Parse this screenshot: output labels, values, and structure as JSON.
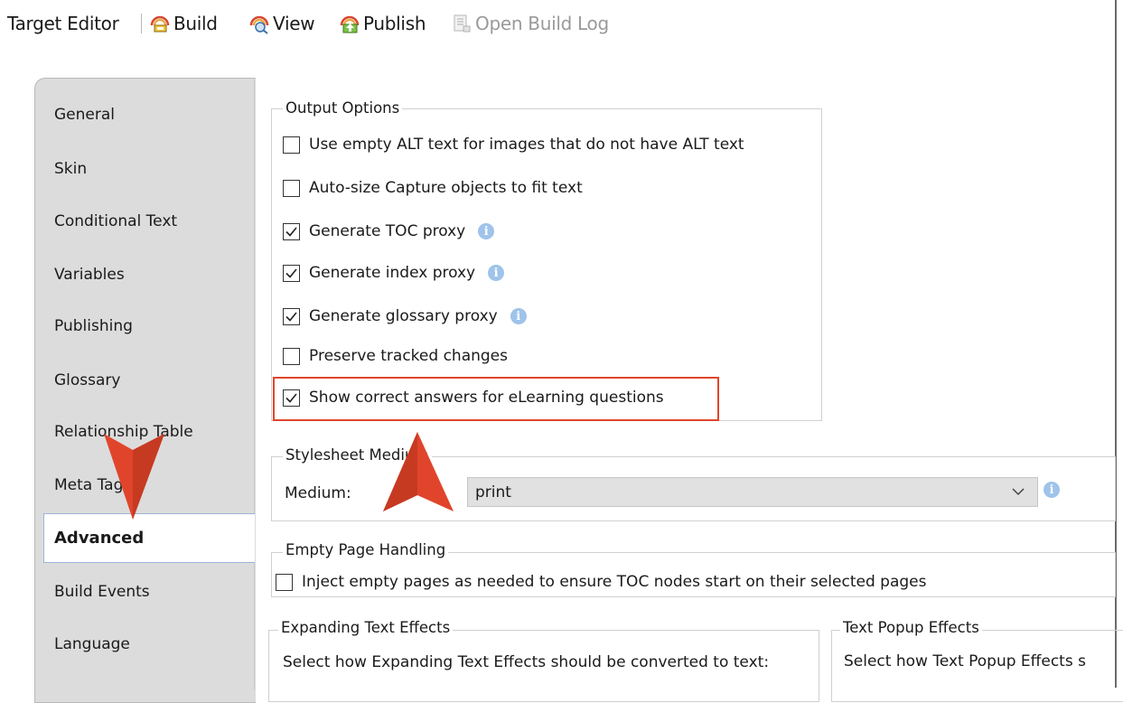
{
  "toolbar": {
    "title": "Target Editor",
    "build": "Build",
    "view": "View",
    "publish": "Publish",
    "open_build_log": "Open Build Log"
  },
  "tabs": [
    {
      "label": "General"
    },
    {
      "label": "Skin"
    },
    {
      "label": "Conditional Text"
    },
    {
      "label": "Variables"
    },
    {
      "label": "Publishing"
    },
    {
      "label": "Glossary"
    },
    {
      "label": "Relationship Table"
    },
    {
      "label": "Meta Tags"
    },
    {
      "label": "Advanced",
      "active": true
    },
    {
      "label": "Build Events"
    },
    {
      "label": "Language"
    }
  ],
  "output_options": {
    "legend": "Output Options",
    "items": [
      {
        "label": "Use empty ALT text for images that do not have ALT text",
        "checked": false,
        "info": false
      },
      {
        "label": "Auto-size Capture objects to fit text",
        "checked": false,
        "info": false
      },
      {
        "label": "Generate TOC proxy",
        "checked": true,
        "info": true
      },
      {
        "label": "Generate index proxy",
        "checked": true,
        "info": true
      },
      {
        "label": "Generate glossary proxy",
        "checked": true,
        "info": true
      },
      {
        "label": "Preserve tracked changes",
        "checked": false,
        "info": false
      },
      {
        "label": "Show correct answers for eLearning questions",
        "checked": true,
        "info": false,
        "highlighted": true
      }
    ]
  },
  "stylesheet_medium": {
    "legend": "Stylesheet Medium",
    "field_label": "Medium:",
    "value": "print"
  },
  "empty_page_handling": {
    "legend": "Empty Page Handling",
    "option_label": "Inject empty pages as needed to ensure TOC nodes start on their selected pages",
    "checked": false
  },
  "expanding_text_effects": {
    "legend": "Expanding Text Effects",
    "description": "Select how Expanding Text Effects should be converted to text:"
  },
  "text_popup_effects": {
    "legend": "Text Popup Effects",
    "description": "Select how Text Popup Effects s"
  },
  "colors": {
    "highlight": "#e0452c",
    "arrow": "#e0452c",
    "info": "#9fc3ea",
    "tab_bg": "#dcdcdc"
  }
}
